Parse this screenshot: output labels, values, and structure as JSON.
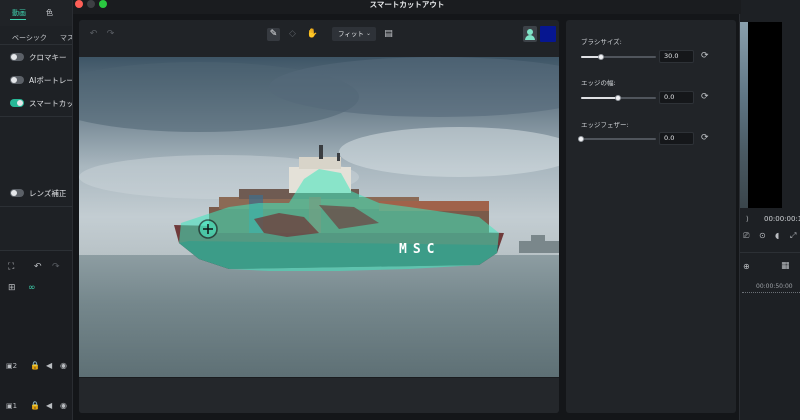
{
  "window": {
    "title": "スマートカットアウト"
  },
  "left_panel": {
    "tabs": [
      {
        "label": "動画",
        "active": true
      },
      {
        "label": "色",
        "active": false
      }
    ],
    "sub_tabs": [
      "ベーシック",
      "マス"
    ],
    "features": [
      {
        "label": "クロマキー",
        "enabled": false
      },
      {
        "label": "AIポートレート",
        "enabled": false
      },
      {
        "label": "スマートカットアウト",
        "enabled": true
      },
      {
        "label": "レンズ補正",
        "enabled": false
      }
    ],
    "tracks": [
      {
        "label": "2"
      },
      {
        "label": "1"
      }
    ]
  },
  "toolbar": {
    "undo_icon": "undo-icon",
    "redo_icon": "redo-icon",
    "brush_icon": "brush-icon",
    "eraser_icon": "eraser-icon",
    "hand_icon": "hand-icon",
    "fit_label": "フィット",
    "fit_chevron": "⌄",
    "compare_icon": "compare-icon",
    "mask_color": "#061690"
  },
  "image": {
    "hull_text": "MSC"
  },
  "settings": {
    "brush_size": {
      "label": "ブラシサイズ:",
      "value": "30.0",
      "level": 0.27
    },
    "edge_width": {
      "label": "エッジの幅:",
      "value": "0.0",
      "level": 0.49
    },
    "edge_feather": {
      "label": "エッジフェザー:",
      "value": "0.0",
      "level": 0.0
    }
  },
  "right_panel": {
    "timecode": "00:00:00:1",
    "ruler_timecode": "00:00:50:00"
  },
  "colors": {
    "accent": "#3fd3b0",
    "selection_overlay": "#3ee8bd"
  }
}
